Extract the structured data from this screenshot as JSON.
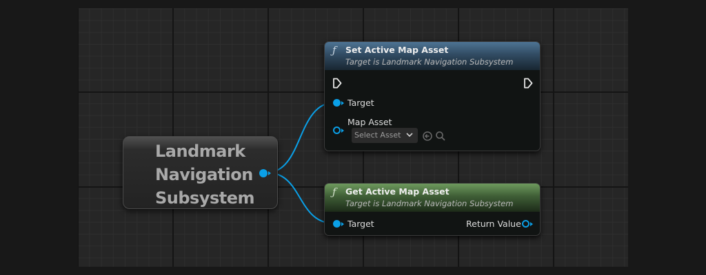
{
  "variable_node": {
    "title_lines": [
      "Landmark",
      "Navigation",
      "Subsystem"
    ]
  },
  "set_node": {
    "icon": "function-icon",
    "title": "Set Active Map Asset",
    "subtitle": "Target is Landmark Navigation Subsystem",
    "header_color": "#4e7494",
    "target_label": "Target",
    "map_asset_label": "Map Asset",
    "select_value": "Select Asset"
  },
  "get_node": {
    "icon": "function-icon",
    "title": "Get Active Map Asset",
    "subtitle": "Target is Landmark Navigation Subsystem",
    "header_color": "#6e9a5e",
    "target_label": "Target",
    "return_label": "Return Value"
  },
  "colors": {
    "object_pin": "#0aa0e8",
    "background": "#262626"
  }
}
